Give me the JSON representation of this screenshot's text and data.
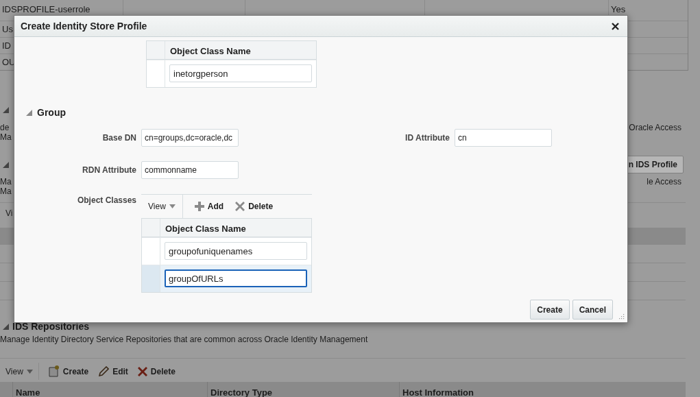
{
  "background": {
    "top_table": {
      "rows": [
        {
          "name": "IDSPROFILE-userrole",
          "column_5": "Yes"
        },
        {
          "name": "Us"
        },
        {
          "name": "ID"
        },
        {
          "name": "OU"
        }
      ]
    },
    "section_1": {
      "expanded": true,
      "description_lines": [
        "de",
        "Ma"
      ],
      "right_text": "Oracle Access"
    },
    "section_2": {
      "expanded": true,
      "button": "n IDS Profile",
      "description_lines": [
        "Ma",
        "Ma"
      ],
      "right_text": "le Access"
    },
    "view_menu": "Vi",
    "ids_repositories": {
      "expanded": true,
      "title": "IDS Repositories",
      "description": "Manage Identity Directory Service Repositories that are common across Oracle Identity Management",
      "toolbar": {
        "view": "View",
        "actions": [
          {
            "kind": "create",
            "label": "Create"
          },
          {
            "kind": "edit",
            "label": "Edit"
          },
          {
            "kind": "delete",
            "label": "Delete"
          }
        ]
      },
      "columns": [
        "Name",
        "Directory Type",
        "Host Information"
      ]
    }
  },
  "dialog": {
    "title": "Create Identity Store Profile",
    "user_object_classes": {
      "column": "Object Class Name",
      "rows": [
        {
          "value": "inetorgperson",
          "selected": false
        }
      ]
    },
    "group": {
      "title": "Group",
      "expanded": true,
      "fields": [
        {
          "label": "Base DN",
          "value": "cn=groups,dc=oracle,dc"
        },
        {
          "label": "RDN Attribute",
          "value": "commonname"
        }
      ],
      "id_attribute": {
        "label": "ID Attribute",
        "value": "cn"
      },
      "object_classes": {
        "label": "Object Classes",
        "toolbar": {
          "view": "View",
          "actions": [
            {
              "kind": "add",
              "label": "Add"
            },
            {
              "kind": "delete",
              "label": "Delete"
            }
          ]
        },
        "column": "Object Class Name",
        "rows": [
          {
            "value": "groupofuniquenames",
            "selected": false
          },
          {
            "value": "groupOfURLs",
            "selected": true
          }
        ]
      }
    },
    "buttons": [
      "Create",
      "Cancel"
    ]
  }
}
